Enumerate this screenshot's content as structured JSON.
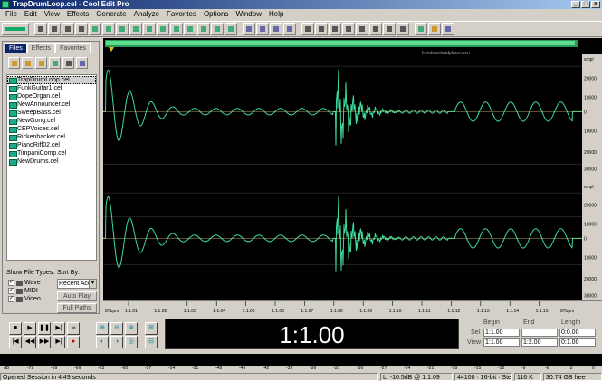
{
  "window": {
    "title": "TrapDrumLoop.cel - Cool Edit Pro",
    "min": "_",
    "max": "□",
    "close": "×"
  },
  "menu": [
    "File",
    "Edit",
    "View",
    "Effects",
    "Generate",
    "Analyze",
    "Favorites",
    "Options",
    "Window",
    "Help"
  ],
  "panel": {
    "tabs": [
      "Files",
      "Effects",
      "Favorites"
    ],
    "files": [
      "TrapDrumLoop.cel",
      "FunkGuitar1.cel",
      "DopeOrgan.cel",
      "NewAnnouncer.cel",
      "SweepBass.cel",
      "NewGong.cel",
      "CEPVoices.cel",
      "Rickenbacker.cel",
      "PianoRiff02.cel",
      "TimpaniComp.cel",
      "NewDrums.cel"
    ],
    "selected_file": "TrapDrumLoop.cel",
    "show_file_types_label": "Show File Types:",
    "sort_by_label": "Sort By:",
    "file_types": [
      {
        "label": "Wave",
        "checked": true
      },
      {
        "label": "MIDI",
        "checked": true
      },
      {
        "label": "Video",
        "checked": true
      }
    ],
    "sort_value": "Recent Acc",
    "auto_play": "Auto Play",
    "full_paths": "Full Paths"
  },
  "waveform": {
    "watermark": "freedownloadplace.com",
    "units_label": "smpl",
    "y_ticks": [
      "20000",
      "10000",
      "0",
      "10000",
      "20000",
      "30000"
    ],
    "timeline_units": "87bpm",
    "timeline_ticks": [
      "1:1.01",
      "1:1.02",
      "1:1.03",
      "1:1.04",
      "1:1.05",
      "1:1.06",
      "1:1.07",
      "1:1.08",
      "1:1.09",
      "1:1.10",
      "1:1.11",
      "1:1.12",
      "1:1.13",
      "1:1.14",
      "1:1.15"
    ],
    "wave_color": "#3ddc9a"
  },
  "time_display": "1:1.00",
  "selection": {
    "headers": [
      "Begin",
      "End",
      "Length"
    ],
    "sel_label": "Sel",
    "view_label": "View",
    "sel": [
      "1:1.00",
      "",
      "0:0.00"
    ],
    "view": [
      "1:1.00",
      "1:2.00",
      "0:1.00"
    ]
  },
  "level_meter": {
    "ticks": [
      "dB",
      "-72",
      "-69",
      "-66",
      "-63",
      "-60",
      "-57",
      "-54",
      "-51",
      "-48",
      "-45",
      "-42",
      "-39",
      "-36",
      "-33",
      "-30",
      "-27",
      "-24",
      "-21",
      "-18",
      "-15",
      "-12",
      "-9",
      "-6",
      "-3",
      "0"
    ]
  },
  "status": {
    "message": "Opened Session in 4.49 seconds",
    "level": "L: -10.5dB @ 1:1.09",
    "format": "44100 · 16-bit · Stereo",
    "size": "116 K",
    "free": "30.74 GB free"
  }
}
